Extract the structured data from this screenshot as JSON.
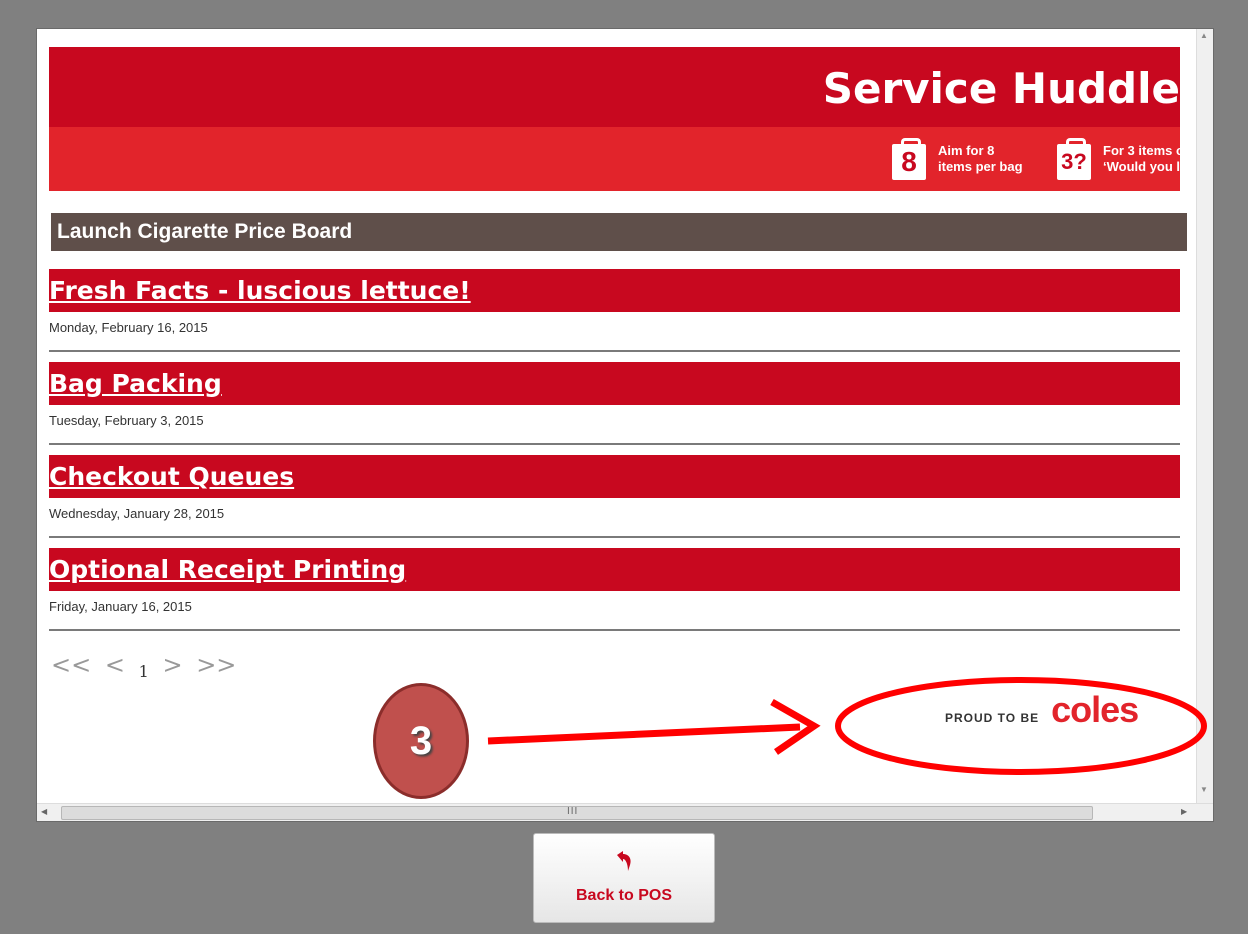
{
  "banner": {
    "title": "Service Huddle",
    "tips": [
      {
        "icon_text": "8",
        "text_line1": "Aim for 8",
        "text_line2": "items per bag"
      },
      {
        "icon_text": "3?",
        "text_line1": "For 3 items o",
        "text_line2": "‘Would you l"
      }
    ]
  },
  "section": {
    "title": "Launch Cigarette Price Board"
  },
  "articles": [
    {
      "title": "Fresh Facts - luscious lettuce!",
      "date": "Monday, February 16, 2015"
    },
    {
      "title": "Bag Packing",
      "date": "Tuesday, February 3, 2015"
    },
    {
      "title": "Checkout Queues",
      "date": "Wednesday, January 28, 2015"
    },
    {
      "title": "Optional Receipt Printing",
      "date": "Friday, January 16, 2015"
    }
  ],
  "pager": {
    "first": "<<",
    "prev": "<",
    "page": "1",
    "next": ">",
    "last": ">>"
  },
  "footer": {
    "proud_text": "PROUD TO BE",
    "logo_text": "coles"
  },
  "scrollbar": {
    "grip": "III"
  },
  "annotation": {
    "number": "3"
  },
  "back_button": {
    "icon": "back-arrow-icon",
    "label": "Back to POS"
  },
  "colors": {
    "brand_red": "#c8081f",
    "banner_light_red": "#e2242b",
    "section_brown": "#5f4f4a",
    "annotation_red": "#ff0000",
    "callout_circle": "#c0504d"
  }
}
